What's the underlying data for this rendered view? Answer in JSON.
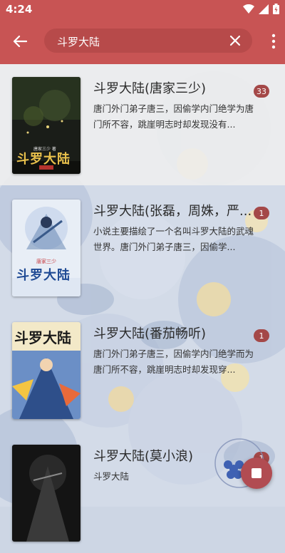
{
  "status": {
    "time": "4:24"
  },
  "search": {
    "query": "斗罗大陆"
  },
  "icons": {
    "back": "arrow-left-icon",
    "clear": "close-icon",
    "more": "more-vertical-icon",
    "stop": "stop-icon",
    "wifi": "wifi-icon",
    "signal": "signal-icon",
    "battery": "battery-icon"
  },
  "colors": {
    "primary": "#c85454",
    "badge": "#a44848",
    "fab": "#b14c52"
  },
  "results": [
    {
      "title": "斗罗大陆(唐家三少)",
      "badge": "33",
      "desc": "唐门外门弟子唐三，因偷学内门绝学为唐门所不容，跳崖明志时却发现没有...",
      "cover_text": "斗罗大陆",
      "cover_author": "唐家三少 著"
    },
    {
      "title": "斗罗大陆(张磊，周姝，严...",
      "badge": "1",
      "desc": "小说主要描绘了一个名叫斗罗大陆的武魂世界。唐门外门弟子唐三，因偷学...",
      "cover_text": "斗罗大陆",
      "cover_author": "唐家三少"
    },
    {
      "title": "斗罗大陆(番茄畅听)",
      "badge": "1",
      "desc": "唐门外门弟子唐三，因偷学内门绝学而为唐门所不容，跳崖明志时却发现穿...",
      "cover_text": "斗罗大陆"
    },
    {
      "title": "斗罗大陆(莫小浪)",
      "badge": "1",
      "desc": "斗罗大陆"
    }
  ]
}
